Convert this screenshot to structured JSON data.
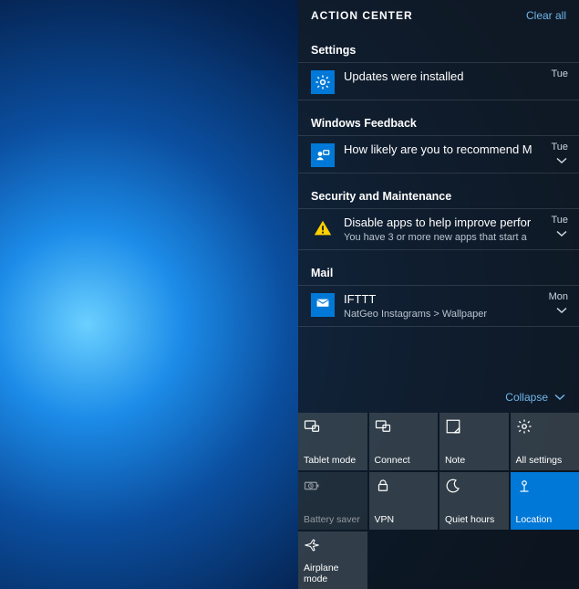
{
  "header": {
    "title": "ACTION CENTER",
    "clear_all": "Clear all"
  },
  "groups": [
    {
      "name": "Settings",
      "items": [
        {
          "icon": "gear",
          "title": "Updates were installed",
          "sub": "",
          "time": "Tue",
          "expandable": false
        }
      ]
    },
    {
      "name": "Windows Feedback",
      "items": [
        {
          "icon": "feedback",
          "title": "How likely are you to recommend M",
          "sub": "",
          "time": "Tue",
          "expandable": true
        }
      ]
    },
    {
      "name": "Security and Maintenance",
      "items": [
        {
          "icon": "warning",
          "title": "Disable apps to help improve perfor",
          "sub": "You have 3 or more new apps that start a",
          "time": "Tue",
          "expandable": true
        }
      ]
    },
    {
      "name": "Mail",
      "items": [
        {
          "icon": "mail",
          "title": "IFTTT",
          "sub": "NatGeo Instagrams > Wallpaper",
          "time": "Mon",
          "expandable": true
        }
      ]
    }
  ],
  "collapse_label": "Collapse",
  "tiles": [
    {
      "label": "Tablet mode",
      "icon": "tablet",
      "state": "normal"
    },
    {
      "label": "Connect",
      "icon": "connect",
      "state": "normal"
    },
    {
      "label": "Note",
      "icon": "note",
      "state": "normal"
    },
    {
      "label": "All settings",
      "icon": "settings",
      "state": "normal"
    },
    {
      "label": "Battery saver",
      "icon": "battery",
      "state": "dim"
    },
    {
      "label": "VPN",
      "icon": "vpn",
      "state": "normal"
    },
    {
      "label": "Quiet hours",
      "icon": "quiet",
      "state": "normal"
    },
    {
      "label": "Location",
      "icon": "location",
      "state": "active"
    },
    {
      "label": "Airplane mode",
      "icon": "airplane",
      "state": "normal"
    }
  ],
  "colors": {
    "accent": "#0078d7",
    "link": "#6fb6e8"
  }
}
